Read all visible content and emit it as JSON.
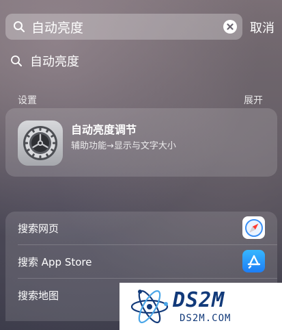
{
  "search": {
    "value": "自动亮度",
    "cancel_label": "取消"
  },
  "suggestion": {
    "text": "自动亮度"
  },
  "settings_section": {
    "title": "设置",
    "expand_label": "展开",
    "result": {
      "title": "自动亮度调节",
      "subtitle": "辅助功能→显示与文字大小",
      "icon": "settings-gear-icon"
    }
  },
  "web_actions": [
    {
      "label": "搜索网页",
      "icon": "safari-icon"
    },
    {
      "label": "搜索 App Store",
      "icon": "app-store-icon"
    },
    {
      "label": "搜索地图",
      "icon": "maps-icon"
    }
  ],
  "watermark": {
    "main": "DS2M",
    "sub": "DS2M.COM"
  },
  "colors": {
    "appstore_blue": "#1d7df5",
    "watermark_navy": "#123a7a"
  }
}
